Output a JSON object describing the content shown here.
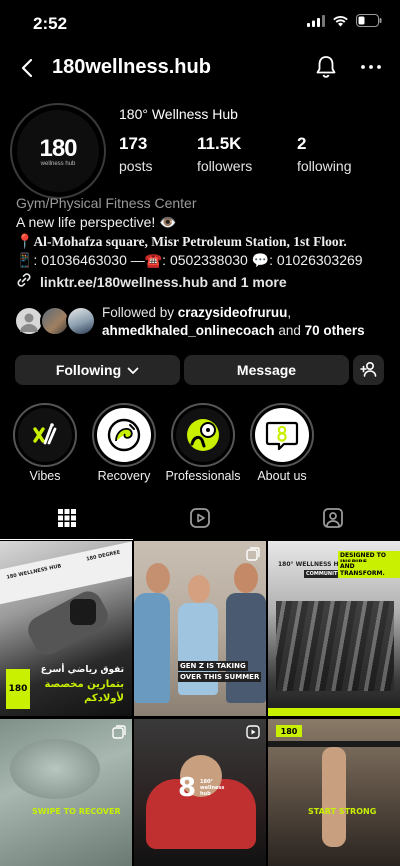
{
  "status_bar": {
    "time": "2:52"
  },
  "header": {
    "username": "180wellness.hub"
  },
  "profile": {
    "name": "180° Wellness Hub",
    "avatar_text": "180",
    "avatar_sub": "wellness hub",
    "stats": [
      {
        "number": "173",
        "label": "posts"
      },
      {
        "number": "11.5K",
        "label": "followers"
      },
      {
        "number": "2",
        "label": "following"
      }
    ]
  },
  "bio": {
    "category": "Gym/Physical Fitness Center",
    "tagline": "A new life perspective! 👁️",
    "address": "Al-Mohafza square, Misr Petroleum Station, 1st Floor.",
    "phones": "📱: 01036463030 —☎️: 0502338030 💬: 01026303269",
    "address_pin": "📍",
    "link": "linktr.ee/180wellness.hub and 1 more"
  },
  "followed_by": {
    "prefix": "Followed by ",
    "user1": "crazysideofruruu",
    "sep": ",",
    "user2": "ahmedkhaled_onlinecoach",
    "and": " and ",
    "others": "70 others"
  },
  "buttons": {
    "following": "Following",
    "message": "Message"
  },
  "highlights": [
    {
      "label": "Vibes"
    },
    {
      "label": "Recovery"
    },
    {
      "label": "Professionals"
    },
    {
      "label": "About us"
    }
  ],
  "posts": {
    "p1_header_left": "180 WELLNESS HUB",
    "p1_header_right": "180 DEGREE",
    "p1_ar1": "تفوق رياضي أسرع",
    "p1_ar2": "بتمارين مخصصة",
    "p1_ar3": "لأولادكم",
    "p1_logo": "180",
    "p2_caption1": "GEN Z IS TAKING",
    "p2_caption2": "OVER THIS SUMMER",
    "p3_header": "180° WELLNESS HUB",
    "p3_tag": "COMMUNITY",
    "p3_title1": "DESIGNED TO INSPIRE",
    "p3_title2": "AND TRANSFORM.",
    "p4_text": "SWIPE TO RECOVER",
    "p5_logo": "8",
    "p5_text": "180° wellness hub",
    "p6_logo": "180",
    "p6_text": "START STRONG"
  },
  "colors": {
    "accent_green": "#c8f000",
    "bg": "#000000",
    "button": "#262626"
  }
}
